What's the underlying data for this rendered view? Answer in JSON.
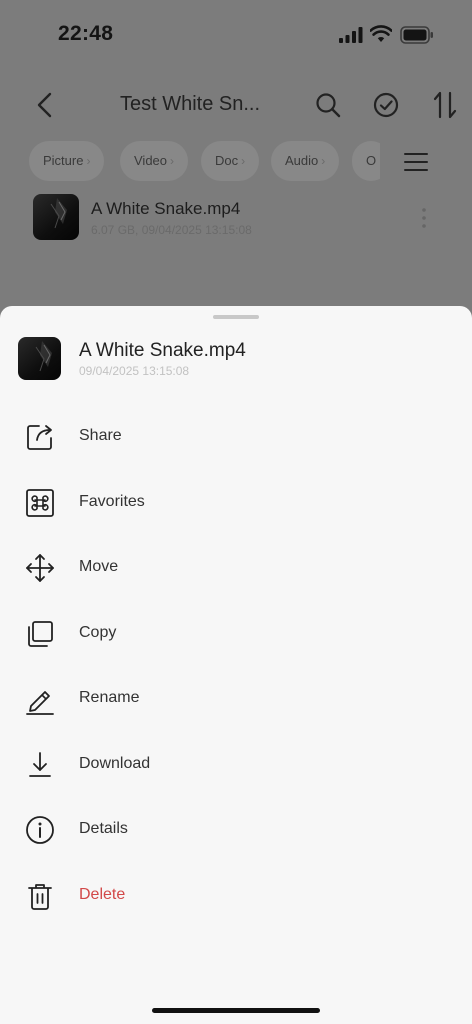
{
  "status_bar": {
    "time": "22:48"
  },
  "nav": {
    "title": "Test White Sn..."
  },
  "filters": [
    "Picture",
    "Video",
    "Doc",
    "Audio",
    "O"
  ],
  "file": {
    "name": "A White Snake.mp4",
    "meta": "6.07 GB, 09/04/2025 13:15:08"
  },
  "sheet": {
    "file_name": "A White Snake.mp4",
    "file_date": "09/04/2025 13:15:08",
    "actions": [
      {
        "label": "Share",
        "icon": "share-icon"
      },
      {
        "label": "Favorites",
        "icon": "command-icon"
      },
      {
        "label": "Move",
        "icon": "move-arrows-icon"
      },
      {
        "label": "Copy",
        "icon": "copy-icon"
      },
      {
        "label": "Rename",
        "icon": "pencil-icon"
      },
      {
        "label": "Download",
        "icon": "download-icon"
      },
      {
        "label": "Details",
        "icon": "info-icon"
      },
      {
        "label": "Delete",
        "icon": "trash-icon"
      }
    ]
  },
  "colors": {
    "overlay": "#7c7c7c",
    "sheet_bg": "#f7f7f7",
    "danger": "#d24848"
  }
}
